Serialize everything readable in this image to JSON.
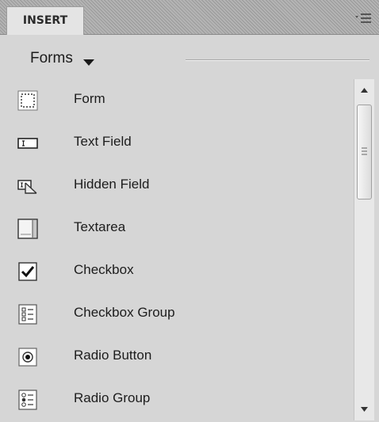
{
  "panel": {
    "tab_label": "INSERT",
    "menu_icon": "panel-menu-icon"
  },
  "category": {
    "label": "Forms",
    "caret_icon": "caret-down-icon"
  },
  "items": [
    {
      "label": "Form",
      "icon": "form-icon"
    },
    {
      "label": "Text Field",
      "icon": "text-field-icon"
    },
    {
      "label": "Hidden Field",
      "icon": "hidden-field-icon"
    },
    {
      "label": "Textarea",
      "icon": "textarea-icon"
    },
    {
      "label": "Checkbox",
      "icon": "checkbox-icon"
    },
    {
      "label": "Checkbox Group",
      "icon": "checkbox-group-icon"
    },
    {
      "label": "Radio Button",
      "icon": "radio-button-icon"
    },
    {
      "label": "Radio Group",
      "icon": "radio-group-icon"
    }
  ],
  "scrollbar": {
    "up_icon": "scroll-up-icon",
    "down_icon": "scroll-down-icon",
    "grip_icon": "grip-icon"
  }
}
